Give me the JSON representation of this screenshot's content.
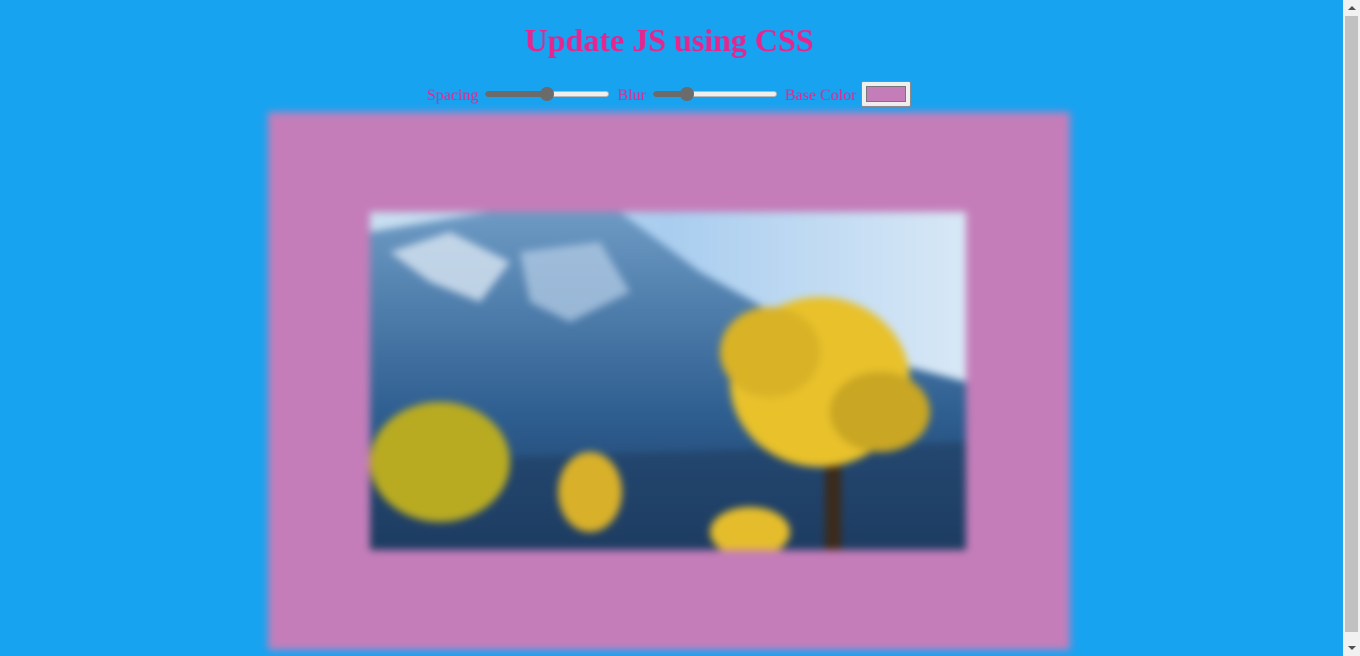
{
  "page": {
    "title": "Update JS using CSS",
    "background_color": "#18a3f0",
    "accent_color": "#e5268f"
  },
  "controls": {
    "spacing": {
      "label": "Spacing",
      "value": 0.5
    },
    "blur": {
      "label": "Blur",
      "value": 0.28
    },
    "base_color": {
      "label": "Base Color",
      "value": "#c47db9"
    }
  },
  "image": {
    "icon": "landscape-photo",
    "description_visible": ""
  }
}
